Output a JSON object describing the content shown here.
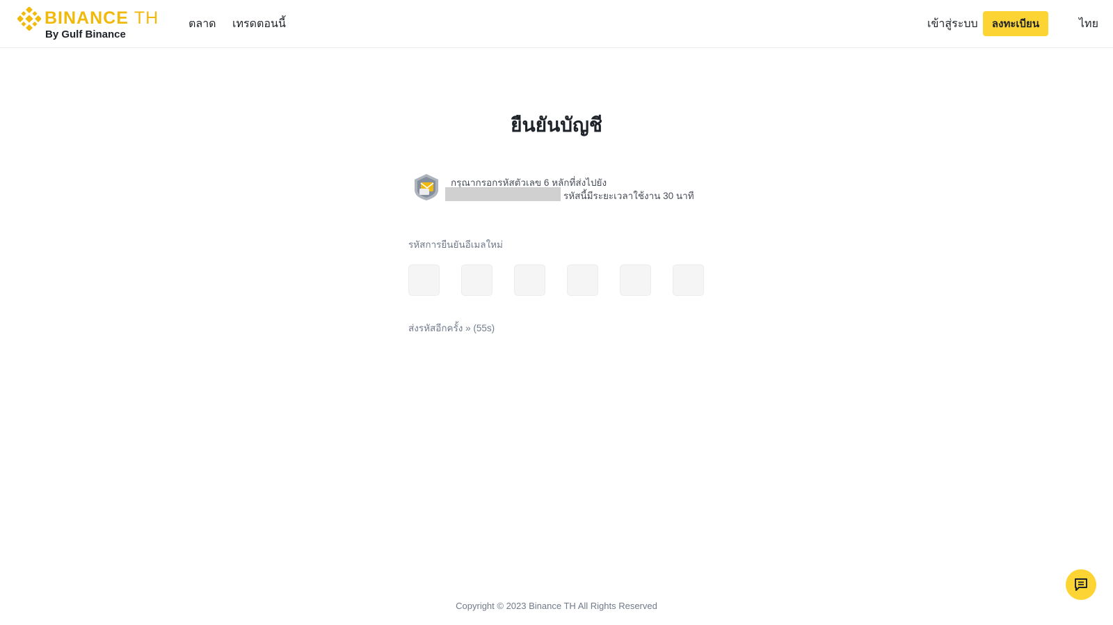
{
  "header": {
    "brand": "BINANCE",
    "brand_suffix": "TH",
    "brand_sub": "By Gulf Binance",
    "nav": [
      "ตลาด",
      "เทรดตอนนี้"
    ],
    "login": "เข้าสู่ระบบ",
    "register": "ลงทะเบียน",
    "language": "ไทย"
  },
  "main": {
    "title": "ยืนยันบัญชี",
    "info_line1": "กรุณากรอกรหัสตัวเลข 6 หลักที่ส่งไปยัง",
    "info_line2": "รหัสนี้มีระยะเวลาใช้งาน 30 นาที",
    "field_label": "รหัสการยืนยันอีเมลใหม่",
    "resend": "ส่งรหัสอีกครั้ง » (55s)"
  },
  "footer": {
    "copyright": "Copyright © 2023 Binance TH All Rights Reserved"
  },
  "colors": {
    "brand_yellow": "#F0B90B",
    "button_yellow": "#FCD535"
  },
  "icons": {
    "logo": "binance-diamond-icon",
    "badge": "email-shield-icon",
    "chat": "chat-icon"
  }
}
